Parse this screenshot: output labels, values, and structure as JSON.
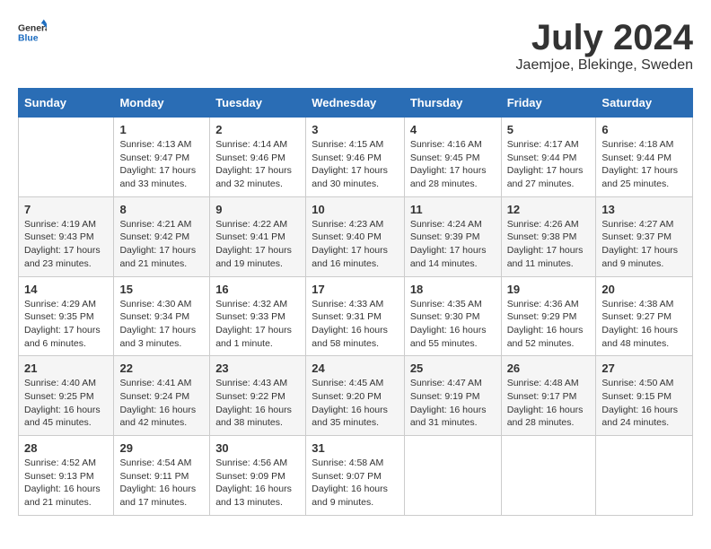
{
  "logo": {
    "general": "General",
    "blue": "Blue"
  },
  "title": "July 2024",
  "location": "Jaemjoe, Blekinge, Sweden",
  "days_of_week": [
    "Sunday",
    "Monday",
    "Tuesday",
    "Wednesday",
    "Thursday",
    "Friday",
    "Saturday"
  ],
  "weeks": [
    [
      {
        "day": "",
        "info": ""
      },
      {
        "day": "1",
        "info": "Sunrise: 4:13 AM\nSunset: 9:47 PM\nDaylight: 17 hours\nand 33 minutes."
      },
      {
        "day": "2",
        "info": "Sunrise: 4:14 AM\nSunset: 9:46 PM\nDaylight: 17 hours\nand 32 minutes."
      },
      {
        "day": "3",
        "info": "Sunrise: 4:15 AM\nSunset: 9:46 PM\nDaylight: 17 hours\nand 30 minutes."
      },
      {
        "day": "4",
        "info": "Sunrise: 4:16 AM\nSunset: 9:45 PM\nDaylight: 17 hours\nand 28 minutes."
      },
      {
        "day": "5",
        "info": "Sunrise: 4:17 AM\nSunset: 9:44 PM\nDaylight: 17 hours\nand 27 minutes."
      },
      {
        "day": "6",
        "info": "Sunrise: 4:18 AM\nSunset: 9:44 PM\nDaylight: 17 hours\nand 25 minutes."
      }
    ],
    [
      {
        "day": "7",
        "info": "Sunrise: 4:19 AM\nSunset: 9:43 PM\nDaylight: 17 hours\nand 23 minutes."
      },
      {
        "day": "8",
        "info": "Sunrise: 4:21 AM\nSunset: 9:42 PM\nDaylight: 17 hours\nand 21 minutes."
      },
      {
        "day": "9",
        "info": "Sunrise: 4:22 AM\nSunset: 9:41 PM\nDaylight: 17 hours\nand 19 minutes."
      },
      {
        "day": "10",
        "info": "Sunrise: 4:23 AM\nSunset: 9:40 PM\nDaylight: 17 hours\nand 16 minutes."
      },
      {
        "day": "11",
        "info": "Sunrise: 4:24 AM\nSunset: 9:39 PM\nDaylight: 17 hours\nand 14 minutes."
      },
      {
        "day": "12",
        "info": "Sunrise: 4:26 AM\nSunset: 9:38 PM\nDaylight: 17 hours\nand 11 minutes."
      },
      {
        "day": "13",
        "info": "Sunrise: 4:27 AM\nSunset: 9:37 PM\nDaylight: 17 hours\nand 9 minutes."
      }
    ],
    [
      {
        "day": "14",
        "info": "Sunrise: 4:29 AM\nSunset: 9:35 PM\nDaylight: 17 hours\nand 6 minutes."
      },
      {
        "day": "15",
        "info": "Sunrise: 4:30 AM\nSunset: 9:34 PM\nDaylight: 17 hours\nand 3 minutes."
      },
      {
        "day": "16",
        "info": "Sunrise: 4:32 AM\nSunset: 9:33 PM\nDaylight: 17 hours\nand 1 minute."
      },
      {
        "day": "17",
        "info": "Sunrise: 4:33 AM\nSunset: 9:31 PM\nDaylight: 16 hours\nand 58 minutes."
      },
      {
        "day": "18",
        "info": "Sunrise: 4:35 AM\nSunset: 9:30 PM\nDaylight: 16 hours\nand 55 minutes."
      },
      {
        "day": "19",
        "info": "Sunrise: 4:36 AM\nSunset: 9:29 PM\nDaylight: 16 hours\nand 52 minutes."
      },
      {
        "day": "20",
        "info": "Sunrise: 4:38 AM\nSunset: 9:27 PM\nDaylight: 16 hours\nand 48 minutes."
      }
    ],
    [
      {
        "day": "21",
        "info": "Sunrise: 4:40 AM\nSunset: 9:25 PM\nDaylight: 16 hours\nand 45 minutes."
      },
      {
        "day": "22",
        "info": "Sunrise: 4:41 AM\nSunset: 9:24 PM\nDaylight: 16 hours\nand 42 minutes."
      },
      {
        "day": "23",
        "info": "Sunrise: 4:43 AM\nSunset: 9:22 PM\nDaylight: 16 hours\nand 38 minutes."
      },
      {
        "day": "24",
        "info": "Sunrise: 4:45 AM\nSunset: 9:20 PM\nDaylight: 16 hours\nand 35 minutes."
      },
      {
        "day": "25",
        "info": "Sunrise: 4:47 AM\nSunset: 9:19 PM\nDaylight: 16 hours\nand 31 minutes."
      },
      {
        "day": "26",
        "info": "Sunrise: 4:48 AM\nSunset: 9:17 PM\nDaylight: 16 hours\nand 28 minutes."
      },
      {
        "day": "27",
        "info": "Sunrise: 4:50 AM\nSunset: 9:15 PM\nDaylight: 16 hours\nand 24 minutes."
      }
    ],
    [
      {
        "day": "28",
        "info": "Sunrise: 4:52 AM\nSunset: 9:13 PM\nDaylight: 16 hours\nand 21 minutes."
      },
      {
        "day": "29",
        "info": "Sunrise: 4:54 AM\nSunset: 9:11 PM\nDaylight: 16 hours\nand 17 minutes."
      },
      {
        "day": "30",
        "info": "Sunrise: 4:56 AM\nSunset: 9:09 PM\nDaylight: 16 hours\nand 13 minutes."
      },
      {
        "day": "31",
        "info": "Sunrise: 4:58 AM\nSunset: 9:07 PM\nDaylight: 16 hours\nand 9 minutes."
      },
      {
        "day": "",
        "info": ""
      },
      {
        "day": "",
        "info": ""
      },
      {
        "day": "",
        "info": ""
      }
    ]
  ]
}
